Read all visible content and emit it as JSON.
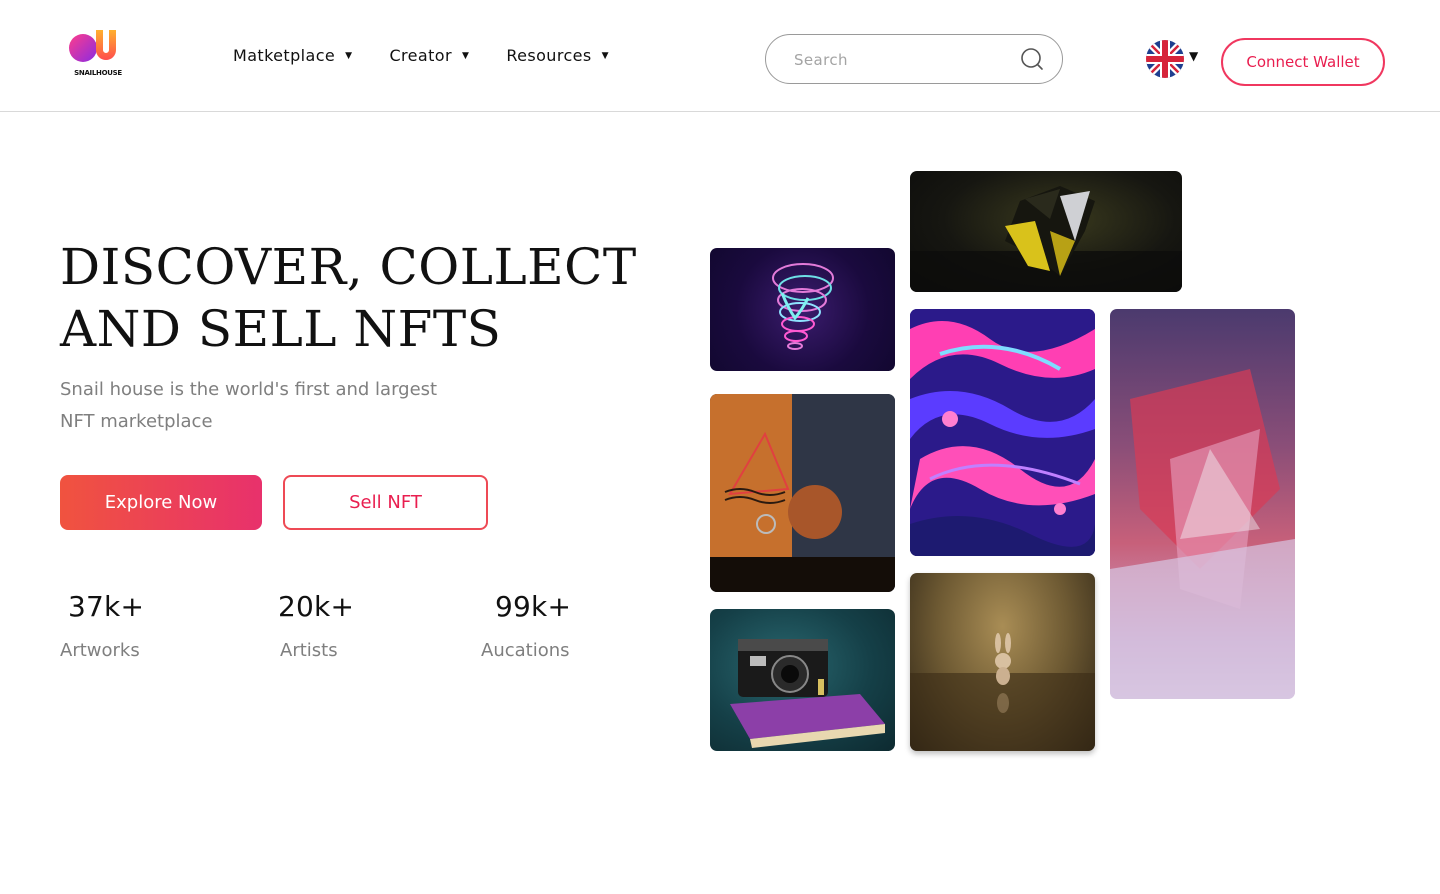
{
  "brand": {
    "name": "SNAILHOUSE",
    "colors": {
      "accent_start": "#f0533f",
      "accent_end": "#e8316c",
      "accent_text": "#e91e4f"
    }
  },
  "nav": {
    "items": [
      {
        "label": "Matketplace",
        "icon": "caret-down-icon"
      },
      {
        "label": "Creator",
        "icon": "caret-down-icon"
      },
      {
        "label": "Resources",
        "icon": "caret-down-icon"
      }
    ]
  },
  "search": {
    "placeholder": "Search",
    "value": "",
    "icon": "search-icon"
  },
  "language": {
    "icon": "uk-flag-icon",
    "caret": "caret-down-icon"
  },
  "header": {
    "connect_wallet_label": "Connect Wallet"
  },
  "hero": {
    "title_line1": "DISCOVER, COLLECT",
    "title_line2": "AND SELL NFTS",
    "subtitle_line1": "Snail house is the world's first and largest",
    "subtitle_line2": "NFT marketplace",
    "explore_label": "Explore Now",
    "sell_label": "Sell NFT"
  },
  "stats": [
    {
      "value": "37k+",
      "label": "Artworks"
    },
    {
      "value": "20k+",
      "label": "Artists"
    },
    {
      "value": "99k+",
      "label": "Aucations"
    }
  ],
  "gallery": [
    {
      "name": "dark-geometric-art"
    },
    {
      "name": "neon-head-art"
    },
    {
      "name": "fluid-marble-art"
    },
    {
      "name": "abstract-pink-art"
    },
    {
      "name": "still-life-sphere-art"
    },
    {
      "name": "bunny-toy-art"
    },
    {
      "name": "camera-book-art"
    }
  ]
}
